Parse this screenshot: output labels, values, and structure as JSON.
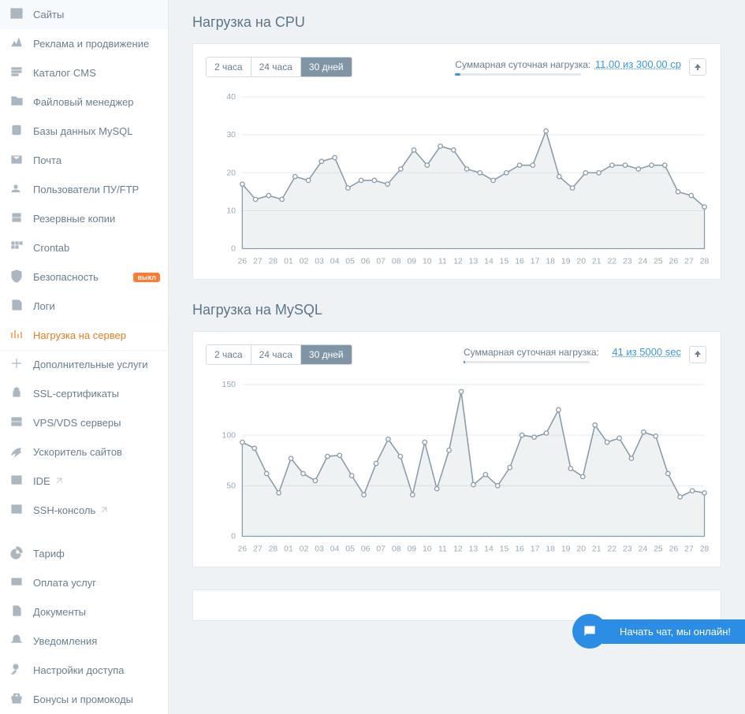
{
  "sidebar": {
    "group1": [
      {
        "name": "sites",
        "label": "Сайты"
      },
      {
        "name": "promo",
        "label": "Реклама и продвижение"
      },
      {
        "name": "cms",
        "label": "Каталог CMS"
      },
      {
        "name": "filemgr",
        "label": "Файловый менеджер"
      },
      {
        "name": "mysql",
        "label": "Базы данных MySQL"
      },
      {
        "name": "mail",
        "label": "Почта"
      },
      {
        "name": "users",
        "label": "Пользователи ПУ/FTP"
      },
      {
        "name": "backup",
        "label": "Резервные копии"
      },
      {
        "name": "crontab",
        "label": "Crontab"
      },
      {
        "name": "security",
        "label": "Безопасность",
        "badge": "выкл"
      },
      {
        "name": "logs",
        "label": "Логи"
      },
      {
        "name": "load",
        "label": "Нагрузка на сервер",
        "active": true
      },
      {
        "name": "extra",
        "label": "Дополнительные услуги"
      },
      {
        "name": "ssl",
        "label": "SSL-сертификаты"
      },
      {
        "name": "vps",
        "label": "VPS/VDS серверы"
      },
      {
        "name": "speedup",
        "label": "Ускоритель сайтов"
      },
      {
        "name": "ide",
        "label": "IDE",
        "ext": true
      },
      {
        "name": "ssh",
        "label": "SSH-консоль",
        "ext": true
      }
    ],
    "group2": [
      {
        "name": "tariff",
        "label": "Тариф"
      },
      {
        "name": "pay",
        "label": "Оплата услуг"
      },
      {
        "name": "docs",
        "label": "Документы"
      },
      {
        "name": "notify",
        "label": "Уведомления"
      },
      {
        "name": "access",
        "label": "Настройки доступа"
      },
      {
        "name": "bonus",
        "label": "Бонусы и промокоды"
      }
    ]
  },
  "time_buttons": {
    "h2": "2 часа",
    "h24": "24 часа",
    "d30": "30 дней"
  },
  "summary_label": "Суммарная суточная нагрузка:",
  "cpu": {
    "title": "Нагрузка на CPU",
    "summary_value": "11.00 из 300.00 cp",
    "bar_pct": 4
  },
  "mysql": {
    "title": "Нагрузка на MySQL",
    "summary_value": "41 из 5000 sec",
    "bar_pct": 1
  },
  "chat": {
    "text": "Начать чат, мы онлайн!"
  },
  "chart_data": [
    {
      "title": "Нагрузка на CPU",
      "type": "line",
      "ylabel": "",
      "xlabel": "",
      "ylim": [
        0,
        40
      ],
      "yticks": [
        0,
        10,
        20,
        30,
        40
      ],
      "categories": [
        "26",
        "27",
        "28",
        "01",
        "02",
        "03",
        "04",
        "05",
        "06",
        "07",
        "08",
        "09",
        "10",
        "11",
        "12",
        "13",
        "14",
        "15",
        "16",
        "17",
        "18",
        "19",
        "20",
        "21",
        "22",
        "23",
        "24",
        "25",
        "26",
        "27",
        "28"
      ],
      "values": [
        17,
        13,
        14,
        13,
        19,
        18,
        23,
        24,
        16,
        18,
        18,
        17,
        21,
        26,
        22,
        27,
        26,
        21,
        20,
        18,
        20,
        22,
        22,
        31,
        19,
        16,
        20,
        20,
        22,
        22,
        21,
        22,
        22,
        15,
        14,
        11
      ]
    },
    {
      "title": "Нагрузка на MySQL",
      "type": "line",
      "ylabel": "",
      "xlabel": "",
      "ylim": [
        0,
        150
      ],
      "yticks": [
        0,
        50,
        100,
        150
      ],
      "categories": [
        "26",
        "27",
        "28",
        "01",
        "02",
        "03",
        "04",
        "05",
        "06",
        "07",
        "08",
        "09",
        "10",
        "11",
        "12",
        "13",
        "14",
        "15",
        "16",
        "17",
        "18",
        "19",
        "20",
        "21",
        "22",
        "23",
        "24",
        "25",
        "26",
        "27",
        "28"
      ],
      "values": [
        93,
        87,
        62,
        43,
        77,
        62,
        55,
        79,
        80,
        60,
        41,
        72,
        96,
        79,
        41,
        93,
        47,
        85,
        143,
        51,
        61,
        50,
        68,
        100,
        98,
        102,
        125,
        67,
        59,
        110,
        93,
        97,
        77,
        103,
        99,
        62,
        39,
        45,
        43
      ]
    }
  ]
}
